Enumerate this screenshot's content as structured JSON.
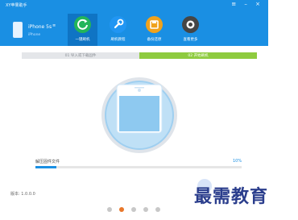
{
  "app": {
    "title": "XY苹果助手",
    "window_controls": "≡ – ×"
  },
  "device": {
    "name": "iPhone 5s",
    "menu_glyph": "≡",
    "model": "iPhone"
  },
  "nav": [
    {
      "label": "一键刷机",
      "icon": "refresh-icon",
      "color": "#23b55a",
      "glyph": "↻",
      "active": true
    },
    {
      "label": "刷机教程",
      "icon": "wrench-icon",
      "color": "#2196f3",
      "glyph": "🔧",
      "active": false
    },
    {
      "label": "备份还原",
      "icon": "backup-icon",
      "color": "#f0a21b",
      "glyph": "▣",
      "active": false
    },
    {
      "label": "查看更多",
      "icon": "camera-icon",
      "color": "#454545",
      "glyph": "◉",
      "active": false
    }
  ],
  "steps": {
    "step1": "01 导入或下载固件",
    "step2": "02 开始刷机"
  },
  "status": {
    "label": "解压固件文件",
    "percent_text": "10%",
    "progress": 0.1
  },
  "version": "版本: 1.0.0.0",
  "watermark": "最需教育",
  "pager": {
    "count": 5,
    "active_index": 1
  },
  "colors": {
    "brand_blue": "#1a8fe3",
    "step_green": "#8ecb3f",
    "pager_active": "#e8772a"
  }
}
